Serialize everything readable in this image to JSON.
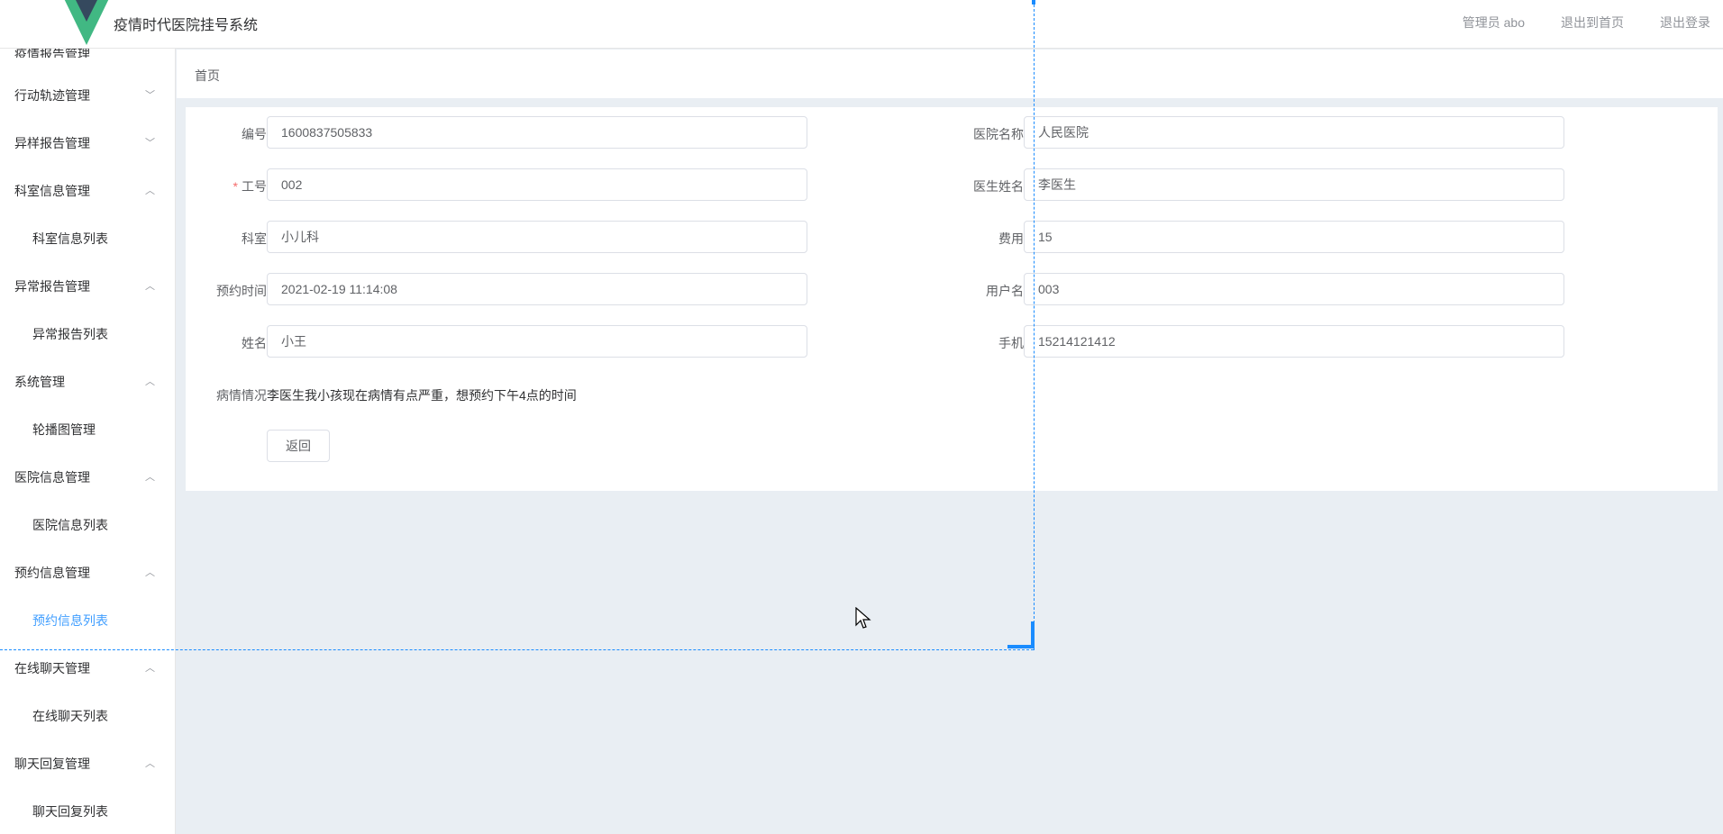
{
  "header": {
    "title": "疫情时代医院挂号系统",
    "admin_label": "管理员 abo",
    "exit_home": "退出到首页",
    "logout": "退出登录"
  },
  "sidebar": {
    "cut_top": "疫情报告管理",
    "groups": [
      {
        "label": "行动轨迹管理",
        "arrow": "﹀"
      },
      {
        "label": "异样报告管理",
        "arrow": "﹀"
      },
      {
        "label": "科室信息管理",
        "arrow": "︿",
        "child": "科室信息列表"
      },
      {
        "label": "异常报告管理",
        "arrow": "︿",
        "child": "异常报告列表"
      },
      {
        "label": "系统管理",
        "arrow": "︿",
        "child": "轮播图管理"
      },
      {
        "label": "医院信息管理",
        "arrow": "︿",
        "child": "医院信息列表"
      },
      {
        "label": "预约信息管理",
        "arrow": "︿",
        "child": "预约信息列表"
      },
      {
        "label": "在线聊天管理",
        "arrow": "︿",
        "child": "在线聊天列表"
      },
      {
        "label": "聊天回复管理",
        "arrow": "︿",
        "child": "聊天回复列表"
      }
    ]
  },
  "breadcrumb": "首页",
  "form": {
    "id_label": "编号",
    "id_value": "1600837505833",
    "hospital_label": "医院名称",
    "hospital_value": "人民医院",
    "job_label": "工号",
    "job_value": "002",
    "doctor_label": "医生姓名",
    "doctor_value": "李医生",
    "dept_label": "科室",
    "dept_value": "小儿科",
    "fee_label": "费用",
    "fee_value": "15",
    "time_label": "预约时间",
    "time_value": "2021-02-19 11:14:08",
    "user_label": "用户名",
    "user_value": "003",
    "name_label": "姓名",
    "name_value": "小王",
    "phone_label": "手机",
    "phone_value": "15214121412",
    "condition_label": "病情情况",
    "condition_value": "李医生我小孩现在病情有点严重，想预约下午4点的时间",
    "back_button": "返回",
    "required_mark": "*"
  },
  "colors": {
    "accent": "#409eff",
    "selection": "#1a8cff",
    "logo_green": "#41b883",
    "logo_dark": "#35495e"
  }
}
